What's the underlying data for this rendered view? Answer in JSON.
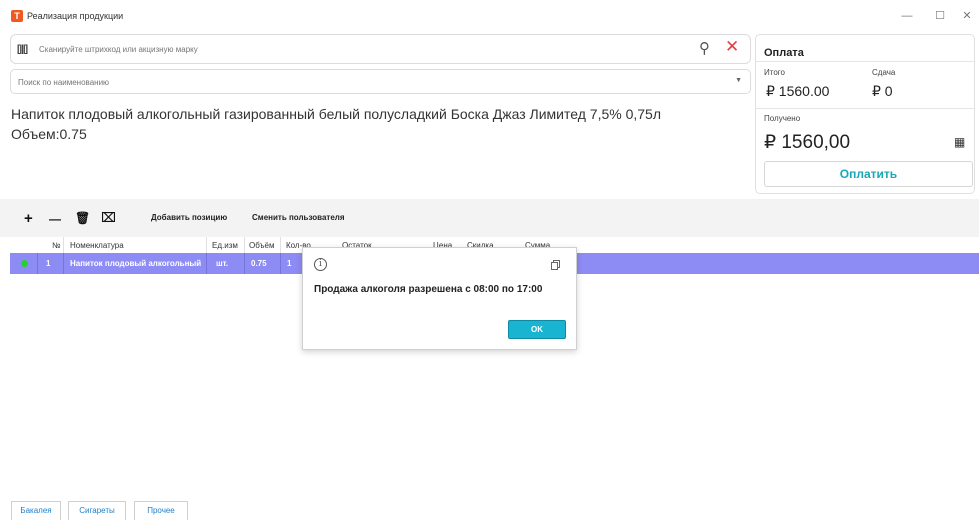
{
  "window": {
    "title": "Реализация продукции",
    "app_icon_glyph": "T",
    "minimize_glyph": "—",
    "maximize_glyph": "☐",
    "close_glyph": "✕"
  },
  "scan": {
    "placeholder": "Сканируйте штрихкод или акцизную марку",
    "barcode_glyph": "[|||]",
    "search_glyph": "⚲",
    "clear_glyph": "✕"
  },
  "name_search": {
    "placeholder": "Поиск по наименованию",
    "dropdown_glyph": "▼"
  },
  "product": {
    "title": "Напиток плодовый алкогольный газированный белый полусладкий Боска Джаз Лимитед 7,5% 0,75л",
    "volume": "Объем:0.75"
  },
  "payment": {
    "title": "Оплата",
    "total_label": "Итого",
    "total_value": "₽ 1560.00",
    "change_label": "Сдача",
    "change_value": "₽ 0",
    "received_label": "Получено",
    "received_value": "₽ 1560,00",
    "calculator_glyph": "▦",
    "pay_button": "Оплатить"
  },
  "toolbar": {
    "plus_glyph": "+",
    "minus_glyph": "—",
    "delete_glyph": "🗑",
    "delete_all_glyph": "⌧",
    "add_position": "Добавить позицию",
    "change_user": "Сменить пользователя"
  },
  "table": {
    "columns": [
      "№",
      "Номенклатура",
      "Ед.изм",
      "Объём",
      "Кол-во",
      "Остаток",
      "Цена",
      "Скидка",
      "Сумма"
    ],
    "selected_row": {
      "num": "1",
      "name": "Напиток плодовый алкогольный",
      "unit": "шт.",
      "volume": "0.75",
      "qty": "1"
    }
  },
  "dialog": {
    "info_glyph": "i",
    "message": "Продажа алкоголя разрешена с 08:00 по 17:00",
    "ok_button": "OK"
  },
  "categories": [
    "Бакалея",
    "Сигареты",
    "Прочее"
  ],
  "colors": {
    "accent": "#19a7b8",
    "selected_row": "#8d8cf4",
    "ok_button": "#19b4d2",
    "status_ok": "#27d227",
    "clear_icon": "#e04040"
  }
}
